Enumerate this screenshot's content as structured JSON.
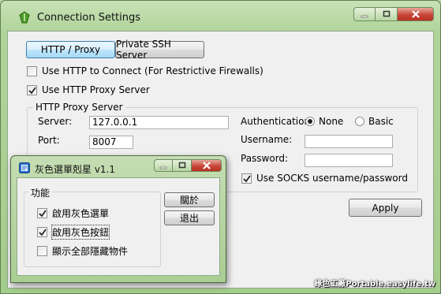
{
  "window": {
    "title": "Connection Settings"
  },
  "tabs": [
    {
      "label": "HTTP / Proxy"
    },
    {
      "label": "Private SSH Server"
    }
  ],
  "options": {
    "use_http_connect": {
      "label": "Use HTTP to Connect (For Restrictive Firewalls)",
      "checked": false
    },
    "use_http_proxy": {
      "label": "Use HTTP Proxy Server",
      "checked": true
    }
  },
  "proxy": {
    "group_label": "HTTP Proxy Server",
    "server_label": "Server:",
    "server_value": "127.0.0.1",
    "port_label": "Port:",
    "port_value": "8007",
    "auth_label": "Authentication:",
    "auth_options": [
      "None",
      "Basic"
    ],
    "auth_selected": "None",
    "username_label": "Username:",
    "username_value": "",
    "password_label": "Password:",
    "password_value": "",
    "socks_label": "Use SOCKS username/password",
    "socks_checked": true
  },
  "apply_label": "Apply",
  "dialog": {
    "title": "灰色選單剋星 v1.1",
    "group_label": "功能",
    "options": [
      {
        "label": "啟用灰色選單",
        "checked": true
      },
      {
        "label": "啟用灰色按鈕",
        "checked": true
      },
      {
        "label": "顯示全部隱藏物件",
        "checked": false
      }
    ],
    "about_label": "關於",
    "exit_label": "退出"
  },
  "watermark": "綠色工廠Portable.easylife.tw",
  "colors": {
    "frame": "#a4cc8b",
    "client": "#f0f0f0",
    "close": "#c8473a"
  }
}
